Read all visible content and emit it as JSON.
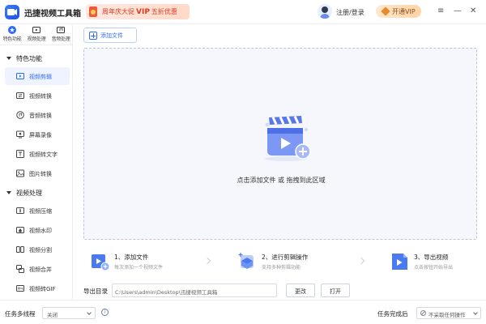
{
  "titlebar": {
    "app_title": "迅捷视频工具箱",
    "promo_prefix": "周年庆大促",
    "promo_vip": "VIP",
    "promo_suffix": "五折优惠",
    "login_label": "注册/登录",
    "vip_button": "开通VIP",
    "menu_icon": "≡",
    "minimize_icon": "—",
    "close_icon": "✕"
  },
  "sidebar": {
    "top_tabs": [
      {
        "label": "特色功能",
        "icon": "star-icon"
      },
      {
        "label": "视频处理",
        "icon": "video-icon"
      },
      {
        "label": "音频处理",
        "icon": "music-icon"
      }
    ],
    "section1": "特色功能",
    "section1_items": [
      {
        "label": "视频剪辑",
        "icon": "scissors-icon",
        "active": true
      },
      {
        "label": "视频转换",
        "icon": "convert-icon"
      },
      {
        "label": "音频转换",
        "icon": "audio-icon"
      },
      {
        "label": "屏幕录像",
        "icon": "record-icon"
      },
      {
        "label": "视频转文字",
        "icon": "text-icon"
      },
      {
        "label": "图片转换",
        "icon": "image-icon"
      }
    ],
    "section2": "视频处理",
    "section2_items": [
      {
        "label": "视频压缩",
        "icon": "compress-icon"
      },
      {
        "label": "视频水印",
        "icon": "watermark-icon"
      },
      {
        "label": "视频分割",
        "icon": "split-icon"
      },
      {
        "label": "视频合并",
        "icon": "merge-icon"
      },
      {
        "label": "视频转GIF",
        "icon": "gif-icon"
      }
    ]
  },
  "main": {
    "add_file_button": "添加文件",
    "drop_text": "点击添加文件 或 拖拽到此区域",
    "steps": [
      {
        "title": "1、添加文件",
        "sub": "每次添加一个视频文件"
      },
      {
        "title": "2、进行剪辑操作",
        "sub": "支持多种剪辑功能"
      },
      {
        "title": "3、导出视频",
        "sub": "点击按钮开始导出"
      }
    ],
    "export_label": "导出目录",
    "export_path": "C:\\Users\\admin\\Desktop\\迅捷视频工具箱",
    "change_button": "更改",
    "open_button": "打开"
  },
  "statusbar": {
    "multithread_label": "任务多线程",
    "multithread_value": "关闭",
    "info_icon": "i",
    "after_done_label": "任务完成后",
    "after_done_value": "不采取任何操作"
  },
  "colors": {
    "accent": "#2d6af6",
    "vip": "#e98b2a",
    "promo": "#e03a20"
  }
}
